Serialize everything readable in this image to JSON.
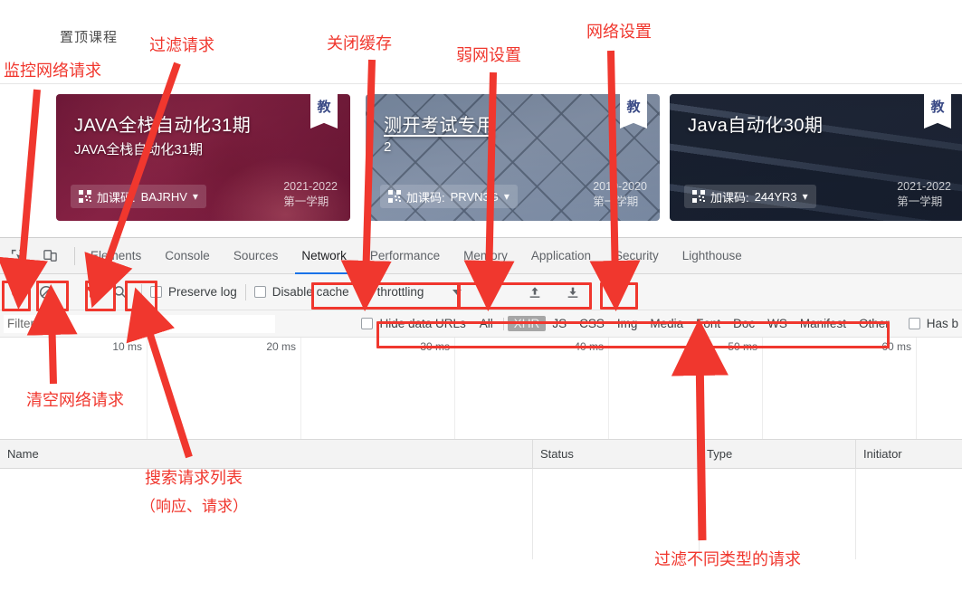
{
  "page": {
    "section_label": "置顶课程",
    "cards": [
      {
        "title": "JAVA全栈自动化31期",
        "subtitle": "JAVA全栈自动化31期",
        "code_label": "加课码:",
        "code": "BAJRHV",
        "term_year": "2021-2022",
        "term_name": "第一学期",
        "flag": "教"
      },
      {
        "title": "测开考试专用",
        "subtitle": "2",
        "code_label": "加课码:",
        "code": "PRVN3G",
        "term_year": "2019-2020",
        "term_name": "第一学期",
        "flag": "教"
      },
      {
        "title": "Java自动化30期",
        "subtitle": "",
        "code_label": "加课码:",
        "code": "244YR3",
        "term_year": "2021-2022",
        "term_name": "第一学期",
        "flag": "教"
      }
    ]
  },
  "devtools": {
    "tabs": [
      {
        "label": "Elements",
        "active": false
      },
      {
        "label": "Console",
        "active": false
      },
      {
        "label": "Sources",
        "active": false
      },
      {
        "label": "Network",
        "active": true
      },
      {
        "label": "Performance",
        "active": false
      },
      {
        "label": "Memory",
        "active": false
      },
      {
        "label": "Application",
        "active": false
      },
      {
        "label": "Security",
        "active": false
      },
      {
        "label": "Lighthouse",
        "active": false
      }
    ],
    "toolbar": {
      "record_title": "record-button",
      "clear_title": "clear-button",
      "filter_title": "filter-button",
      "search_title": "search-button",
      "preserve_log_label": "Preserve log",
      "disable_cache_label": "Disable cache",
      "throttling_value": "No throttling",
      "network_conditions_title": "network-conditions",
      "import_title": "import-har",
      "export_title": "export-har"
    },
    "filterbar": {
      "filter_placeholder": "Filter",
      "filter_value": "",
      "hide_data_urls_label": "Hide data URLs",
      "types": [
        "All",
        "XHR",
        "JS",
        "CSS",
        "Img",
        "Media",
        "Font",
        "Doc",
        "WS",
        "Manifest",
        "Other"
      ],
      "selected_type": "XHR",
      "has_blocked_label": "Has b"
    },
    "overview": {
      "ticks": [
        "10 ms",
        "20 ms",
        "30 ms",
        "40 ms",
        "50 ms",
        "60 ms"
      ]
    },
    "table": {
      "columns": [
        "Name",
        "Status",
        "Type",
        "Initiator"
      ]
    }
  },
  "annotations": [
    {
      "id": "a1",
      "text": "监控网络请求"
    },
    {
      "id": "a2",
      "text": "过滤请求"
    },
    {
      "id": "a3",
      "text": "关闭缓存"
    },
    {
      "id": "a4",
      "text": "弱网设置"
    },
    {
      "id": "a5",
      "text": "网络设置"
    },
    {
      "id": "a6",
      "text": "清空网络请求"
    },
    {
      "id": "a7",
      "text": "搜索请求列表"
    },
    {
      "id": "a8",
      "text": "（响应、请求）"
    },
    {
      "id": "a9",
      "text": "过滤不同类型的请求"
    }
  ],
  "colors": {
    "annotation_red": "#f0372e",
    "active_tab_blue": "#1a73e8",
    "record_red": "#e8352b"
  }
}
